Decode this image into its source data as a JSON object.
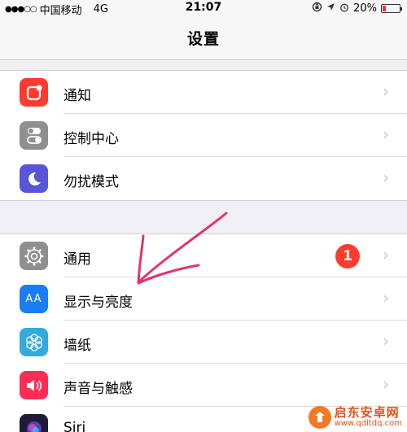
{
  "status_bar": {
    "signal": "●●●○○",
    "carrier": "中国移动",
    "network": "4G",
    "time": "21:07",
    "battery_percent": "20%",
    "battery_level": 0.2
  },
  "nav": {
    "title": "设置"
  },
  "group1": [
    {
      "label": "通知",
      "icon": "notification-icon",
      "color": "#ff3b30"
    },
    {
      "label": "控制中心",
      "icon": "control-center-icon",
      "color": "#8e8e93"
    },
    {
      "label": "勿扰模式",
      "icon": "moon-icon",
      "color": "#5856d6"
    }
  ],
  "group2": [
    {
      "label": "通用",
      "icon": "gear-icon",
      "color": "#8e8e93",
      "badge": "1"
    },
    {
      "label": "显示与亮度",
      "icon": "display-icon",
      "color": "#1c7cf4",
      "icon_text": "AA"
    },
    {
      "label": "墙纸",
      "icon": "flower-icon",
      "color": "#34aadc"
    },
    {
      "label": "声音与触感",
      "icon": "speaker-icon",
      "color": "#ff2d55"
    },
    {
      "label": "Siri",
      "icon": "siri-icon",
      "color": "#1c1c3a"
    }
  ],
  "chevron": "›",
  "watermark": {
    "name": "启东安卓网",
    "url": "www.qdltdq.com"
  }
}
